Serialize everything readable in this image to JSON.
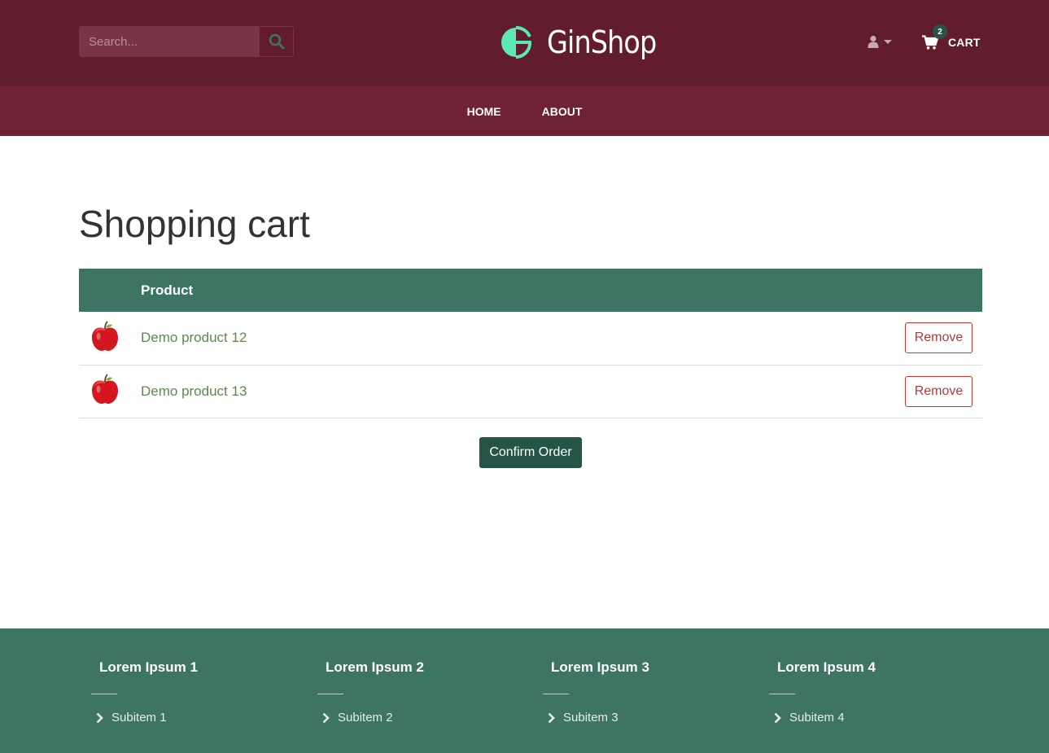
{
  "header": {
    "search_placeholder": "Search...",
    "brand_name": "GinShop",
    "cart_count": "2",
    "cart_label": "CART"
  },
  "nav": {
    "items": [
      {
        "label": "HOME"
      },
      {
        "label": "ABOUT"
      }
    ]
  },
  "main": {
    "title": "Shopping cart",
    "table": {
      "columns": [
        "",
        "Product",
        ""
      ],
      "rows": [
        {
          "product": "Demo product 12",
          "action": "Remove"
        },
        {
          "product": "Demo product 13",
          "action": "Remove"
        }
      ]
    },
    "confirm_label": "Confirm Order"
  },
  "footer": {
    "columns": [
      {
        "heading": "Lorem Ipsum 1",
        "item": "Subitem 1"
      },
      {
        "heading": "Lorem Ipsum 2",
        "item": "Subitem 2"
      },
      {
        "heading": "Lorem Ipsum 3",
        "item": "Subitem 3"
      },
      {
        "heading": "Lorem Ipsum 4",
        "item": "Subitem 4"
      }
    ]
  },
  "colors": {
    "header_bg": "#621d2d",
    "nav_bg": "#6f2234",
    "accent_green": "#3e7463",
    "button_dark_green": "#255546",
    "logo_mint": "#5ee8b5",
    "remove_red": "#c0392b"
  },
  "icons": {
    "search": "search-icon",
    "brand": "ginshop-logo-icon",
    "user": "user-icon",
    "cart": "shopping-cart-icon",
    "product": "apple-icon",
    "footer_bullet": "chevron-right-icon"
  }
}
